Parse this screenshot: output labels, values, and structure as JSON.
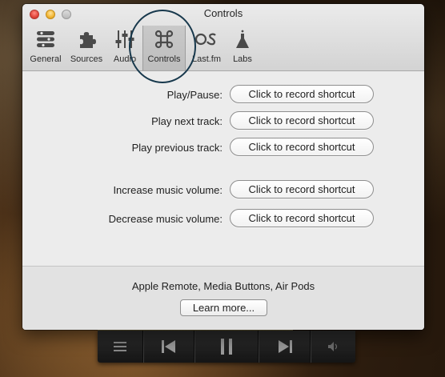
{
  "window": {
    "title": "Controls"
  },
  "toolbar": {
    "tabs": [
      {
        "label": "General",
        "icon": "sliders-stack-icon",
        "selected": false
      },
      {
        "label": "Sources",
        "icon": "puzzle-piece-icon",
        "selected": false
      },
      {
        "label": "Audio",
        "icon": "equalizer-icon",
        "selected": false
      },
      {
        "label": "Controls",
        "icon": "command-key-icon",
        "selected": true
      },
      {
        "label": "Last.fm",
        "icon": "lastfm-icon",
        "selected": false
      },
      {
        "label": "Labs",
        "icon": "flask-icon",
        "selected": false
      }
    ]
  },
  "shortcuts": [
    {
      "label": "Play/Pause:",
      "button": "Click to record shortcut"
    },
    {
      "label": "Play next track:",
      "button": "Click to record shortcut"
    },
    {
      "label": "Play previous track:",
      "button": "Click to record shortcut"
    },
    {
      "label": "Increase music volume:",
      "button": "Click to record shortcut"
    },
    {
      "label": "Decrease music volume:",
      "button": "Click to record shortcut"
    }
  ],
  "footer": {
    "text": "Apple Remote, Media Buttons, Air Pods",
    "learn_more": "Learn more..."
  },
  "player": {
    "buttons": [
      "menu-icon",
      "previous-track-icon",
      "pause-icon",
      "next-track-icon",
      "volume-icon"
    ]
  },
  "colors": {
    "highlight_ring": "#17384c",
    "window_bg": "#ececec",
    "progress": "#b9a862"
  }
}
